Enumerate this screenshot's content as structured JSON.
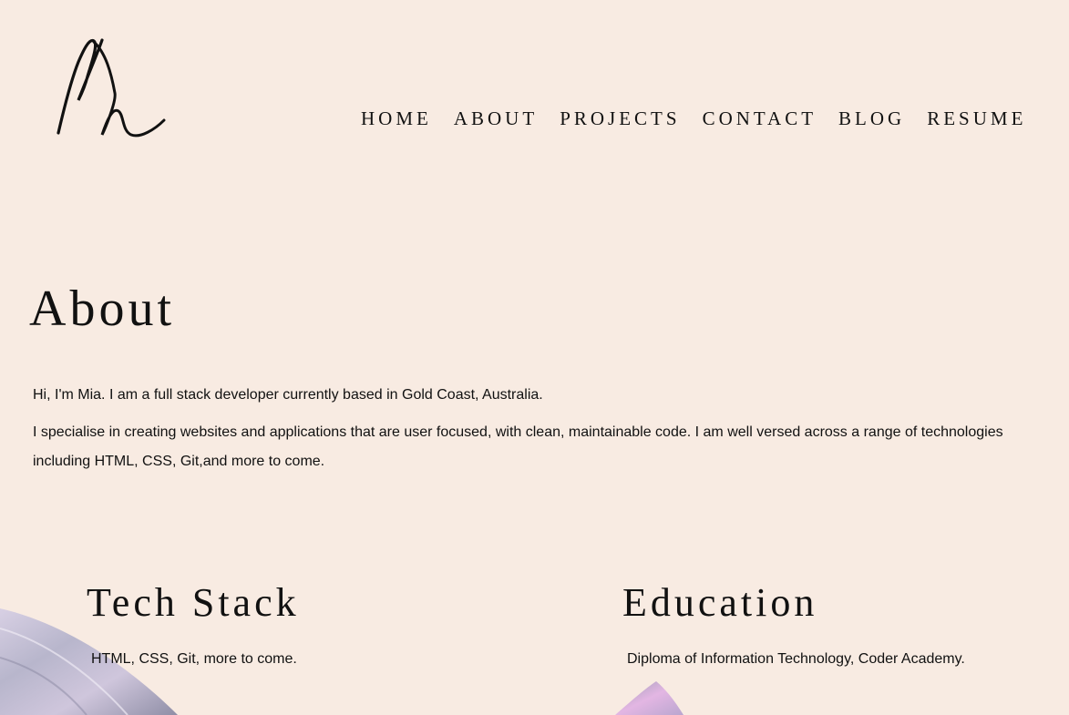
{
  "nav": {
    "items": [
      "Home",
      "About",
      "Projects",
      "Contact",
      "Blog",
      "Resume"
    ]
  },
  "about": {
    "title": "About",
    "paragraph1": "Hi, I'm Mia. I am a full stack developer currently based in Gold Coast, Australia.",
    "paragraph2": "I specialise in creating websites and applications that are user focused, with clean, maintainable code. I am well versed across a range of technologies including HTML, CSS, Git,and more to come."
  },
  "tech_stack": {
    "title": "Tech Stack",
    "text": "HTML, CSS, Git, more to come."
  },
  "education": {
    "title": "Education",
    "text": "Diploma of Information Technology, Coder Academy."
  },
  "colors": {
    "background": "#f8ebe2",
    "text": "#111111"
  }
}
